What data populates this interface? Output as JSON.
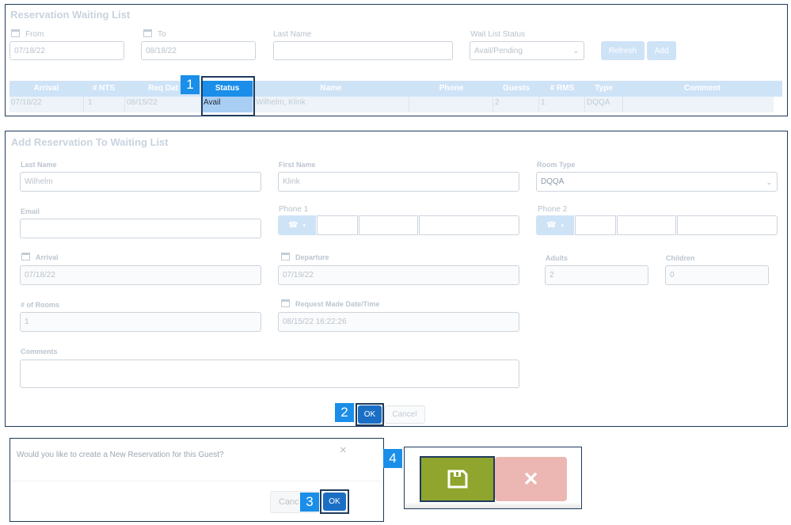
{
  "waitlist": {
    "title": "Reservation Waiting List",
    "from_label": "From",
    "from_value": "07/18/22",
    "to_label": "To",
    "to_value": "08/18/22",
    "lastname_label": "Last Name",
    "lastname_value": "",
    "status_label": "Wait List Status",
    "status_value": "Avail/Pending",
    "refresh_label": "Refresh",
    "add_label": "Add",
    "columns": [
      "Arrival",
      "# NTS",
      "Req Dat",
      "Status",
      "Name",
      "Phone",
      "Guests",
      "# RMS",
      "Type",
      "Comment"
    ],
    "row": {
      "arrival": "07/18/22",
      "nts": "1",
      "req_date": "08/15/22",
      "status": "Avail",
      "name": "Wilhelm, Klink",
      "phone": "",
      "guests": "2",
      "rms": "1",
      "type": "DQQA",
      "comment": ""
    }
  },
  "addform": {
    "title": "Add Reservation To Waiting List",
    "lastname_label": "Last Name",
    "lastname_value": "Wilhelm",
    "firstname_label": "First Name",
    "firstname_value": "Klink",
    "roomtype_label": "Room Type",
    "roomtype_value": "DQQA",
    "email_label": "Email",
    "email_value": "",
    "phone1_label": "Phone 1",
    "phone2_label": "Phone 2",
    "arrival_label": "Arrival",
    "arrival_value": "07/18/22",
    "departure_label": "Departure",
    "departure_value": "07/19/22",
    "adults_label": "Adults",
    "adults_value": "2",
    "children_label": "Children",
    "children_value": "0",
    "rooms_label": "# of Rooms",
    "rooms_value": "1",
    "request_label": "Request Made Date/Time",
    "request_value": "08/15/22 16:22:26",
    "comments_label": "Comments",
    "comments_value": "",
    "ok_label": "OK",
    "cancel_label": "Cancel"
  },
  "dialog": {
    "message": "Would you like to create a New Reservation for this Guest?",
    "close_glyph": "×",
    "cancel_label": "Canc",
    "ok_label": "OK"
  },
  "toolbar": {
    "save_icon": "floppy-disk-icon",
    "close_glyph": "✕"
  },
  "badges": [
    "1",
    "2",
    "3",
    "4"
  ],
  "colors": {
    "accent": "#1a8ee8",
    "ok_button": "#1a6fc4",
    "save_button": "#8fa52e",
    "cancel_button": "#ecb7b2",
    "highlight_border": "#1f3a5c"
  }
}
